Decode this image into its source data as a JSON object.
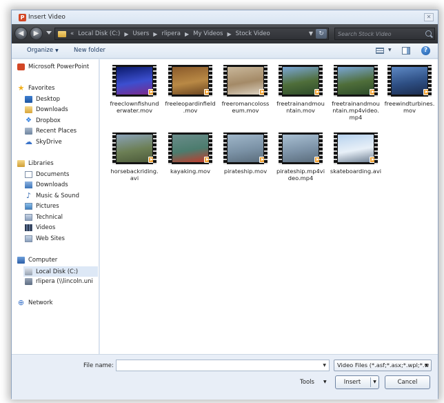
{
  "window": {
    "title": "Insert Video",
    "close_glyph": "✕"
  },
  "address": {
    "back_glyph": "◀",
    "forward_glyph": "▶",
    "overflow": "«",
    "crumbs": [
      "Local Disk (C:)",
      "Users",
      "rlipera",
      "My Videos",
      "Stock Video"
    ],
    "separator": "▶",
    "refresh_glyph": "↻",
    "search_placeholder": "Search Stock Video"
  },
  "toolbar": {
    "organize": "Organize",
    "new_folder": "New folder",
    "help_glyph": "?"
  },
  "nav": {
    "app": "Microsoft PowerPoint",
    "favorites": "Favorites",
    "desktop": "Desktop",
    "downloads": "Downloads",
    "dropbox": "Dropbox",
    "recent": "Recent Places",
    "skydrive": "SkyDrive",
    "libraries": "Libraries",
    "documents": "Documents",
    "lib_downloads": "Downloads",
    "music": "Music & Sound",
    "pictures": "Pictures",
    "technical": "Technical",
    "videos": "Videos",
    "websites": "Web Sites",
    "computer": "Computer",
    "local_disk": "Local Disk (C:)",
    "network_drive": "rlipera (\\\\lincoln.uni",
    "network": "Network"
  },
  "files": [
    {
      "name": "freeclownfishunderwater.mov",
      "l1": "freeclownfishund",
      "l2": "erwater.mov",
      "l3": "",
      "colors": [
        "#0b1a6b",
        "#3c4fd0",
        "#7d2a8c"
      ]
    },
    {
      "name": "freeleopardinfield.mov",
      "l1": "freeleopardinfield",
      "l2": ".mov",
      "l3": "",
      "colors": [
        "#8a5a2a",
        "#b98945",
        "#6b4520"
      ]
    },
    {
      "name": "freeromancolosseum.mov",
      "l1": "freeromancoloss",
      "l2": "eum.mov",
      "l3": "",
      "colors": [
        "#c9b79a",
        "#a48a67",
        "#dcd2c2"
      ]
    },
    {
      "name": "freetrainandmountain.mov",
      "l1": "freetrainandmou",
      "l2": "ntain.mov",
      "l3": "",
      "colors": [
        "#7aa6d6",
        "#4f6e3a",
        "#2d4b2a"
      ]
    },
    {
      "name": "freetrainandmountain.mp4video.mp4",
      "l1": "freetrainandmou",
      "l2": "ntain.mp4video.",
      "l3": "mp4",
      "colors": [
        "#7aa6d6",
        "#4f6e3a",
        "#2d4b2a"
      ]
    },
    {
      "name": "freewindturbines.mov",
      "l1": "freewindturbines.",
      "l2": "mov",
      "l3": "",
      "colors": [
        "#5d88c4",
        "#2e4f84",
        "#1b2c4e"
      ]
    },
    {
      "name": "horsebackriding.avi",
      "l1": "horsebackriding.",
      "l2": "avi",
      "l3": "",
      "colors": [
        "#8aa2b8",
        "#6c7f55",
        "#4c5a3a"
      ]
    },
    {
      "name": "kayaking.mov",
      "l1": "kayaking.mov",
      "l2": "",
      "l3": "",
      "colors": [
        "#6a8c8a",
        "#4c7c6e",
        "#c23a2a"
      ]
    },
    {
      "name": "pirateship.mov",
      "l1": "pirateship.mov",
      "l2": "",
      "l3": "",
      "colors": [
        "#9fb6c9",
        "#7b92a6",
        "#5a6c7b"
      ]
    },
    {
      "name": "pirateship.mp4video.mp4",
      "l1": "pirateship.mp4vi",
      "l2": "deo.mp4",
      "l3": "",
      "colors": [
        "#a8bfd2",
        "#7d93a8",
        "#5a6c7b"
      ]
    },
    {
      "name": "skateboarding.avi",
      "l1": "skateboarding.avi",
      "l2": "",
      "l3": "",
      "colors": [
        "#b7d2ee",
        "#e8f0f8",
        "#6e7f92"
      ]
    }
  ],
  "bottom": {
    "file_name_label": "File name:",
    "file_name_value": "",
    "filter": "Video Files (*.asf;*.asx;*.wpl;*.w",
    "tools": "Tools",
    "insert": "Insert",
    "cancel": "Cancel",
    "drop_glyph": "▼"
  }
}
